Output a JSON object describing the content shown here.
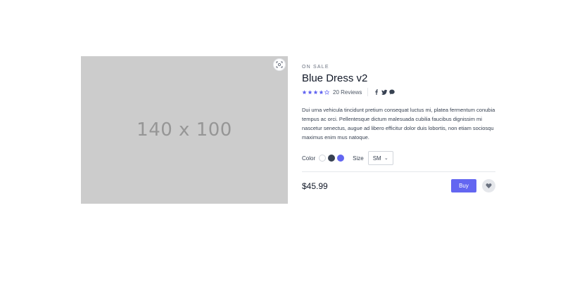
{
  "image": {
    "placeholder_text": "140 x 100"
  },
  "product": {
    "eyebrow": "ON SALE",
    "title": "Blue Dress v2",
    "rating": 4,
    "rating_max": 5,
    "reviews_label": "20 Reviews",
    "social_icons": [
      "facebook-icon",
      "twitter-icon",
      "message-icon"
    ],
    "description": "Dui urna vehicula tincidunt pretium consequat luctus mi, platea fermentum conubia tempus ac orci. Pellentesque dictum malesuada cubilia faucibus dignissim mi nascetur senectus, augue ad libero efficitur dolor duis lobortis, non etiam sociosqu maximus enim mus natoque."
  },
  "options": {
    "color_label": "Color",
    "colors": [
      "#ffffff",
      "#374151",
      "#6366f1"
    ],
    "size_label": "Size",
    "size_value": "SM"
  },
  "purchase": {
    "price": "$45.99",
    "buy_label": "Buy"
  },
  "colors": {
    "accent": "#6366f1",
    "star": "#6366f1",
    "placeholder_bg": "#cccccc"
  }
}
